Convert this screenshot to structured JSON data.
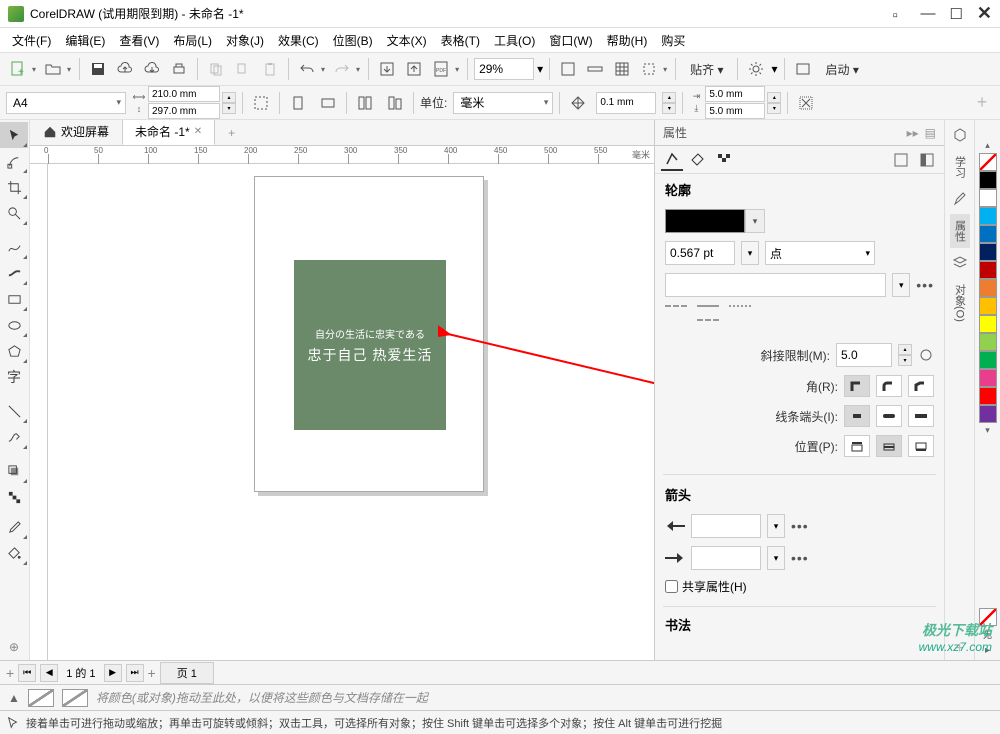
{
  "title": "CorelDRAW (试用期限到期) - 未命名 -1*",
  "menu": [
    "文件(F)",
    "编辑(E)",
    "查看(V)",
    "布局(L)",
    "对象(J)",
    "效果(C)",
    "位图(B)",
    "文本(X)",
    "表格(T)",
    "工具(O)",
    "窗口(W)",
    "帮助(H)",
    "购买"
  ],
  "toolbar": {
    "zoom": "29%",
    "snap": "贴齐 ▾",
    "launch": "启动 ▾"
  },
  "propbar": {
    "pagesize": "A4",
    "width": "210.0 mm",
    "height": "297.0 mm",
    "unitlbl": "单位:",
    "unit": "毫米",
    "nudge": "0.1 mm",
    "dup_x": "5.0 mm",
    "dup_y": "5.0 mm"
  },
  "tabs": {
    "welcome": "欢迎屏幕",
    "doc": "未命名 -1*"
  },
  "ruler_unit": "毫米",
  "canvas": {
    "line1": "自分の生活に忠実である",
    "line2": "忠于自己 热爱生活"
  },
  "panel": {
    "title": "属性",
    "outline": "轮廓",
    "width": "0.567 pt",
    "style": "点",
    "miter_lbl": "斜接限制(M):",
    "miter": "5.0",
    "corner_lbl": "角(R):",
    "cap_lbl": "线条端头(I):",
    "pos_lbl": "位置(P):",
    "arrows": "箭头",
    "share": "共享属性(H)",
    "calli": "书法"
  },
  "vtabs": [
    "学习",
    "属性",
    "对象(O)"
  ],
  "palette_none": "无",
  "palette": [
    "#000000",
    "#ffffff",
    "#00b0f0",
    "#0070c0",
    "#c00000",
    "#ed7d31",
    "#ffff00",
    "#92d050",
    "#00b050",
    "#e83e8c",
    "#ff0000",
    "#7030a0"
  ],
  "pagenav": {
    "info": "1 的 1",
    "pagelbl": "页 1"
  },
  "colorbar_hint": "将颜色(或对象)拖动至此处，以便将这些颜色与文档存储在一起",
  "status": "接着单击可进行拖动或缩放；再单击可旋转或倾斜；双击工具，可选择所有对象；按住 Shift 键单击可选择多个对象；按住 Alt 键单击可进行挖掘",
  "watermark": {
    "l1": "极光下载站",
    "l2": "www.xz7.com"
  }
}
